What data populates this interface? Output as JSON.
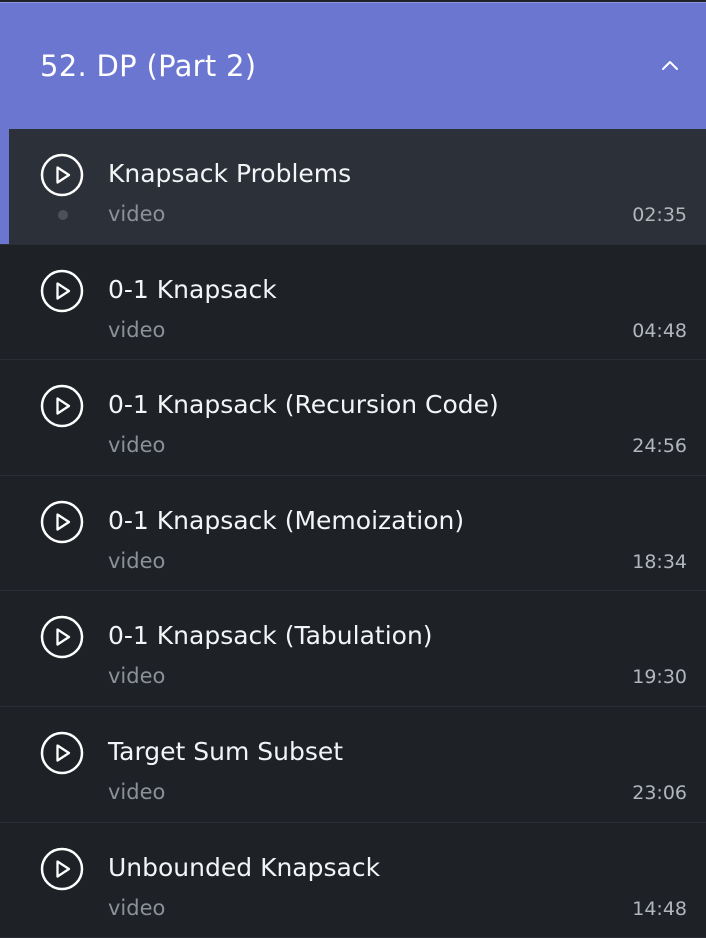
{
  "section": {
    "title": "52. DP (Part 2)",
    "toggle_icon": "chevron-up-icon"
  },
  "colors": {
    "header_bg": "#6b76d1",
    "list_bg": "#1e2126",
    "active_item_bg": "#2c3139",
    "active_accent": "#6b76d1",
    "title_text": "#f3f4f6",
    "type_text": "#8b9099",
    "duration_text": "#b2b6bd"
  },
  "lectures": [
    {
      "title": "Knapsack Problems",
      "type": "video",
      "duration": "02:35",
      "active": true,
      "icon": "play-circle-icon"
    },
    {
      "title": "0-1 Knapsack",
      "type": "video",
      "duration": "04:48",
      "active": false,
      "icon": "play-circle-icon"
    },
    {
      "title": "0-1 Knapsack (Recursion Code)",
      "type": "video",
      "duration": "24:56",
      "active": false,
      "icon": "play-circle-icon"
    },
    {
      "title": "0-1 Knapsack (Memoization)",
      "type": "video",
      "duration": "18:34",
      "active": false,
      "icon": "play-circle-icon"
    },
    {
      "title": "0-1 Knapsack (Tabulation)",
      "type": "video",
      "duration": "19:30",
      "active": false,
      "icon": "play-circle-icon"
    },
    {
      "title": "Target Sum Subset",
      "type": "video",
      "duration": "23:06",
      "active": false,
      "icon": "play-circle-icon"
    },
    {
      "title": "Unbounded Knapsack",
      "type": "video",
      "duration": "14:48",
      "active": false,
      "icon": "play-circle-icon"
    }
  ]
}
